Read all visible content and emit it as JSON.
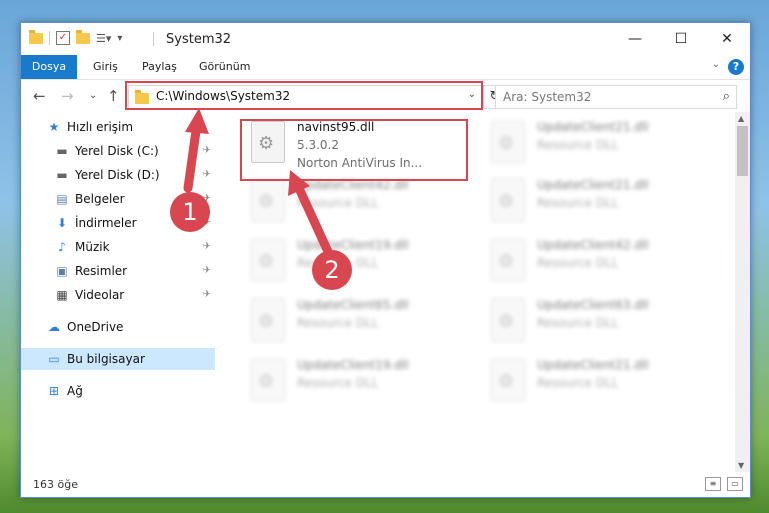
{
  "window": {
    "title": "System32",
    "controls": {
      "minimize": "—",
      "maximize": "☐",
      "close": "✕"
    }
  },
  "ribbon": {
    "tabs": [
      "Dosya",
      "Giriş",
      "Paylaş",
      "Görünüm"
    ],
    "help": "?"
  },
  "nav": {
    "address": "C:\\Windows\\System32",
    "search_placeholder": "Ara: System32"
  },
  "sidebar": {
    "items": [
      {
        "label": "Hızlı erişim",
        "icon": "star-icon",
        "pinned": false
      },
      {
        "label": "Yerel Disk (C:)",
        "icon": "drive-icon",
        "pinned": true
      },
      {
        "label": "Yerel Disk (D:)",
        "icon": "drive-icon",
        "pinned": true
      },
      {
        "label": "Belgeler",
        "icon": "documents-icon",
        "pinned": true
      },
      {
        "label": "İndirmeler",
        "icon": "download-icon",
        "pinned": true
      },
      {
        "label": "Müzik",
        "icon": "music-icon",
        "pinned": true
      },
      {
        "label": "Resimler",
        "icon": "pictures-icon",
        "pinned": true
      },
      {
        "label": "Videolar",
        "icon": "videos-icon",
        "pinned": true
      },
      {
        "label": "OneDrive",
        "icon": "cloud-icon",
        "pinned": false
      },
      {
        "label": "Bu bilgisayar",
        "icon": "computer-icon",
        "pinned": false
      },
      {
        "label": "Ağ",
        "icon": "network-icon",
        "pinned": false
      }
    ]
  },
  "files": {
    "highlighted": {
      "name": "navinst95.dll",
      "version": "5.3.0.2",
      "description": "Norton AntiVirus In..."
    },
    "blurred": [
      {
        "name": "UpdateClient21.dll",
        "type": "Resource DLL"
      },
      {
        "name": "UpdateClient42.dll",
        "type": "Resource DLL"
      },
      {
        "name": "UpdateClient21.dll",
        "type": "Resource DLL"
      },
      {
        "name": "UpdateClient19.dll",
        "type": "Resource DLL"
      },
      {
        "name": "UpdateClient42.dll",
        "type": "Resource DLL"
      },
      {
        "name": "UpdateClient65.dll",
        "type": "Resource DLL"
      },
      {
        "name": "UpdateClient63.dll",
        "type": "Resource DLL"
      },
      {
        "name": "UpdateClient19.dll",
        "type": "Resource DLL"
      },
      {
        "name": "UpdateClient21.dll",
        "type": "Resource DLL"
      }
    ]
  },
  "status": {
    "count": "163 öğe"
  },
  "annotations": {
    "step1": "1",
    "step2": "2",
    "color": "#d8474f"
  }
}
